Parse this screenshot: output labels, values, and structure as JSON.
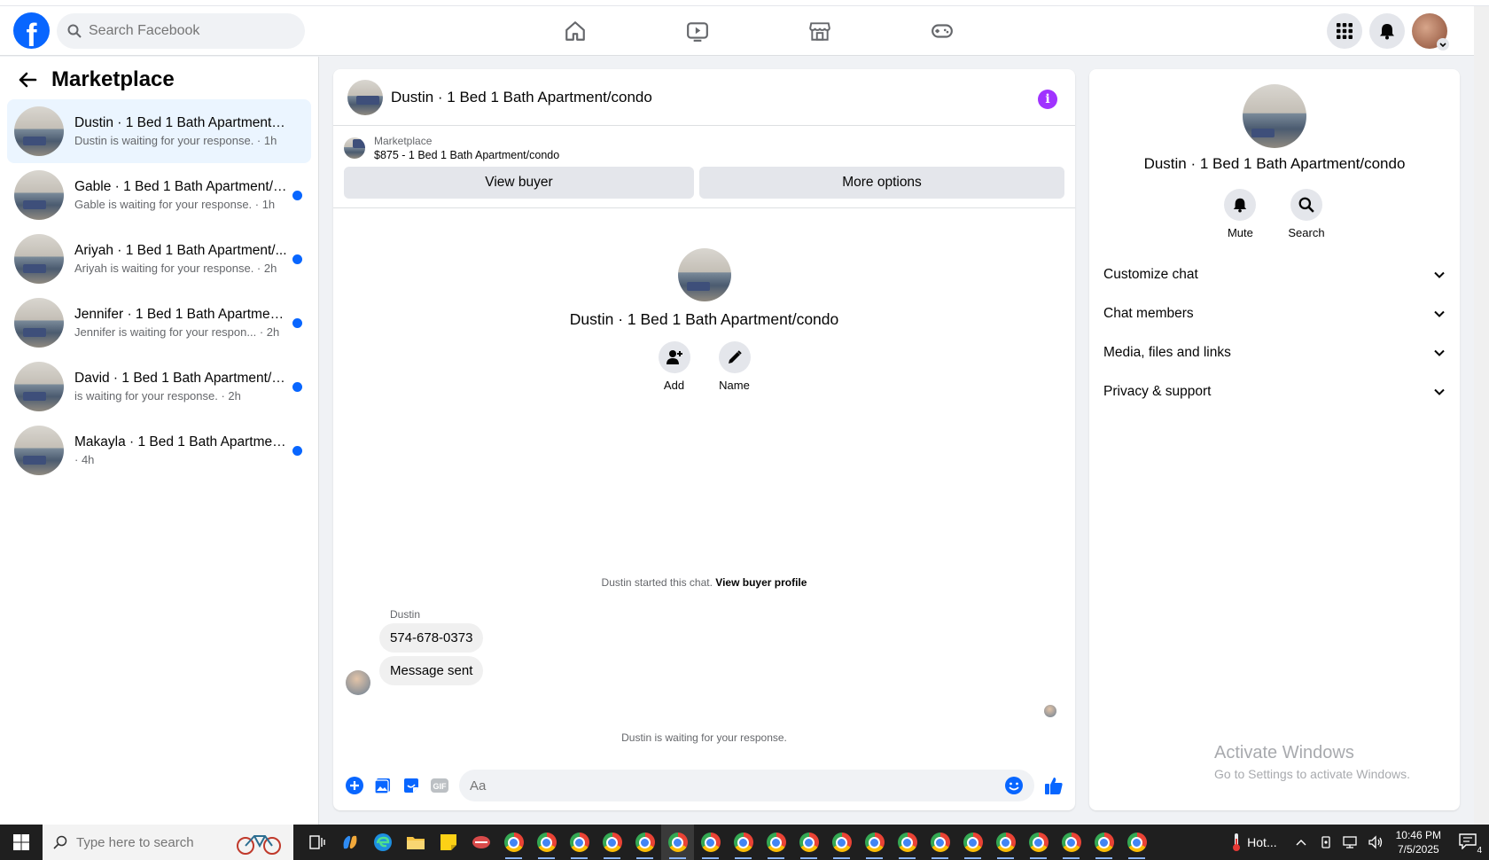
{
  "topbar": {
    "search_placeholder": "Search Facebook"
  },
  "sidebar": {
    "title": "Marketplace",
    "conversations": [
      {
        "title": "Dustin · 1 Bed 1 Bath Apartment/c...",
        "subtitle": "Dustin is waiting for your response. · 1h",
        "active": true,
        "unread": false
      },
      {
        "title": "Gable · 1 Bed 1 Bath Apartment/c...",
        "subtitle": "Gable is waiting for your response. · 1h",
        "active": false,
        "unread": true
      },
      {
        "title": "Ariyah · 1 Bed 1 Bath Apartment/...",
        "subtitle": "Ariyah is waiting for your response. · 2h",
        "active": false,
        "unread": true
      },
      {
        "title": "Jennifer · 1 Bed 1 Bath Apartmen...",
        "subtitle": "Jennifer is waiting for your respon... · 2h",
        "active": false,
        "unread": true
      },
      {
        "title": "David · 1 Bed 1 Bath Apartment/c...",
        "subtitle": "is waiting for your response. · 2h",
        "active": false,
        "unread": true
      },
      {
        "title": "Makayla · 1 Bed 1 Bath Apartmen...",
        "subtitle": "· 4h",
        "active": false,
        "unread": true
      }
    ]
  },
  "chat": {
    "header_title": "Dustin · 1 Bed 1 Bath Apartment/condo",
    "marketplace_label": "Marketplace",
    "listing": "$875 - 1 Bed 1 Bath Apartment/condo",
    "view_buyer_label": "View buyer",
    "more_options_label": "More options",
    "profile_name": "Dustin · 1 Bed 1 Bath Apartment/condo",
    "add_label": "Add",
    "name_label": "Name",
    "started_text": "Dustin started this chat.",
    "view_profile_link": "View buyer profile",
    "sender": "Dustin",
    "messages": [
      "574-678-0373",
      "Message sent"
    ],
    "waiting_text": "Dustin is waiting for your response.",
    "composer_placeholder": "Aa"
  },
  "info_panel": {
    "name": "Dustin · 1 Bed 1 Bath Apartment/condo",
    "mute_label": "Mute",
    "search_label": "Search",
    "sections": [
      "Customize chat",
      "Chat members",
      "Media, files and links",
      "Privacy & support"
    ]
  },
  "watermark": {
    "title": "Activate Windows",
    "subtitle": "Go to Settings to activate Windows."
  },
  "taskbar": {
    "search_placeholder": "Type here to search",
    "weather": "Hot...",
    "time": "10:46 PM",
    "date": "7/5/2025",
    "notification_count": "4"
  },
  "colors": {
    "brand_blue": "#0866ff",
    "active_row": "#ebf5ff",
    "info_purple": "#a033ff"
  }
}
